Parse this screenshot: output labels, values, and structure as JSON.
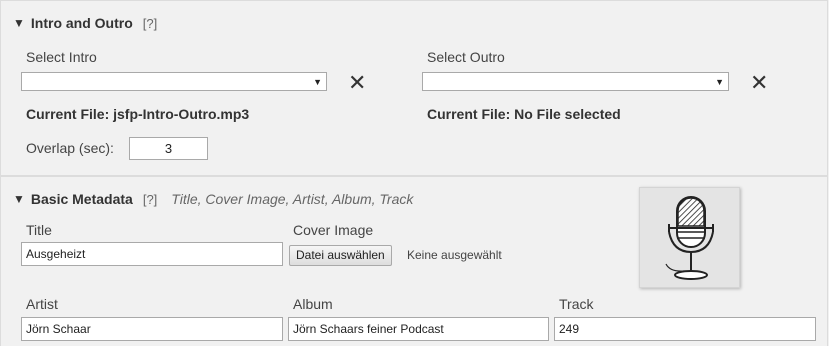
{
  "intro_outro": {
    "title": "Intro and Outro",
    "help": "[?]",
    "select_intro_label": "Select Intro",
    "select_outro_label": "Select Outro",
    "select_intro_value": "",
    "select_outro_value": "",
    "dropdown_glyph": "▼",
    "clear_glyph": "✕",
    "intro_current_file": "Current File: jsfp-Intro-Outro.mp3",
    "outro_current_file": "Current File: No File selected",
    "overlap_label": "Overlap (sec):",
    "overlap_value": "3"
  },
  "basic_metadata": {
    "title": "Basic Metadata",
    "help": "[?]",
    "subtitle": "Title, Cover Image, Artist, Album, Track",
    "title_label": "Title",
    "title_value": "Ausgeheizt",
    "cover_label": "Cover Image",
    "file_button": "Datei auswählen",
    "file_status": "Keine ausgewählt",
    "artist_label": "Artist",
    "artist_value": "Jörn Schaar",
    "album_label": "Album",
    "album_value": "Jörn Schaars feiner Podcast",
    "track_label": "Track",
    "track_value": "249"
  },
  "colors": {
    "background": "#f1f1f1",
    "border": "#dcdcdc",
    "text": "#444444"
  },
  "icons": [
    "triangle-down-icon",
    "close-icon",
    "microphone-icon"
  ]
}
